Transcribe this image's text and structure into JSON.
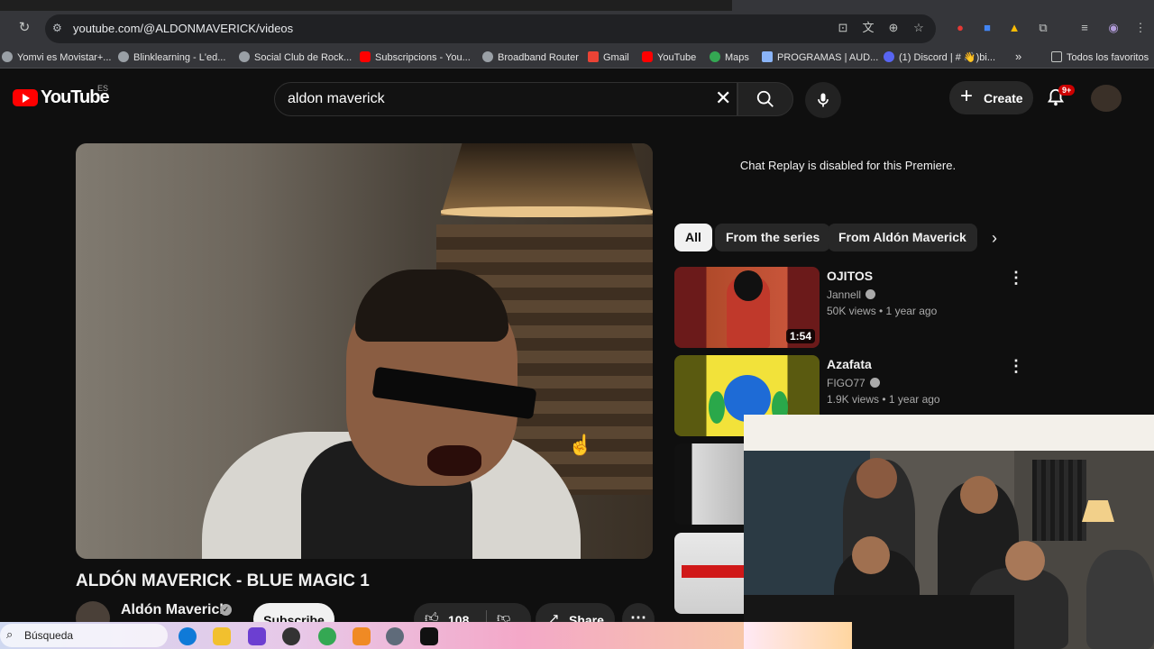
{
  "browser": {
    "url": "youtube.com/@ALDONMAVERICK/videos",
    "bookmarks": [
      "Yomvi es Movistar+...",
      "Blinklearning - L'ed...",
      "Social Club de Rock...",
      "Subscripcions - You...",
      "Broadband Router",
      "Gmail",
      "YouTube",
      "Maps",
      "PROGRAMAS | AUD...",
      "(1) Discord | # 👋)bi...",
      "»",
      "Todos los favoritos"
    ]
  },
  "header": {
    "logo_text": "YouTube",
    "country_code": "ES",
    "search_query": "aldon maverick",
    "create_label": "Create",
    "notification_badge": "9+"
  },
  "video": {
    "title": "ALDÓN MAVERICK - BLUE MAGIC 1",
    "channel_name": "Aldón Maverick",
    "subscribe_label": "Subscribe",
    "likes": "108",
    "share_label": "Share"
  },
  "sidebar": {
    "chat_message": "Chat Replay is disabled for this Premiere.",
    "chips": [
      "All",
      "From the series",
      "From Aldón Maverick"
    ],
    "recommendations": [
      {
        "title": "OJITOS",
        "channel": "Jannell",
        "meta": "50K views • 1 year ago",
        "duration": "1:54"
      },
      {
        "title": "Azafata",
        "channel": "FIGO77",
        "meta": "1.9K views • 1 year ago",
        "duration": ""
      }
    ]
  },
  "taskbar": {
    "search_label": "Búsqueda"
  },
  "colors": {
    "youtube_red": "#ff0000",
    "background": "#0f0f0f",
    "chip_active": "#f1f1f1"
  }
}
